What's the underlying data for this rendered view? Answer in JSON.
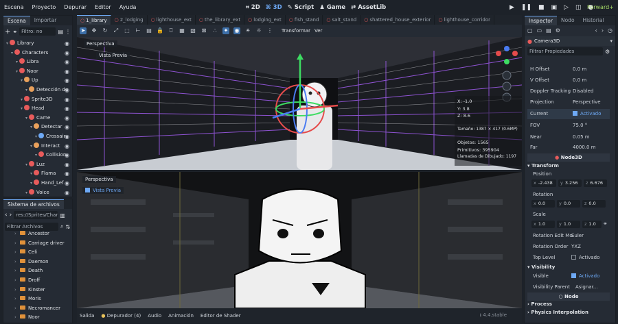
{
  "menubar": {
    "items": [
      "Escena",
      "Proyecto",
      "Depurar",
      "Editor",
      "Ayuda"
    ],
    "workspace_tabs": [
      "2D",
      "3D",
      "Script",
      "Game",
      "AssetLib"
    ],
    "renderer": "Forward+"
  },
  "scene_dock": {
    "tabs": [
      "Escena",
      "Importar"
    ],
    "filter_placeholder": "Filtro: no",
    "tree": [
      {
        "label": "Library",
        "indent": 0,
        "color": "#e85b5b"
      },
      {
        "label": "Characters",
        "indent": 1,
        "color": "#e85b5b"
      },
      {
        "label": "Libra",
        "indent": 2,
        "color": "#e85b5b"
      },
      {
        "label": "Noor",
        "indent": 2,
        "color": "#e85b5b"
      },
      {
        "label": "Up",
        "indent": 3,
        "color": "#e8a05b"
      },
      {
        "label": "Detección de",
        "indent": 4,
        "color": "#e8a05b"
      },
      {
        "label": "Sprite3D",
        "indent": 3,
        "color": "#e85b5b"
      },
      {
        "label": "Head",
        "indent": 3,
        "color": "#e85b5b"
      },
      {
        "label": "Came",
        "indent": 4,
        "color": "#e85b5b"
      },
      {
        "label": "Detectar",
        "indent": 5,
        "color": "#e8a05b"
      },
      {
        "label": "Crossair",
        "indent": 6,
        "color": "#6ea9f5"
      },
      {
        "label": "Interact",
        "indent": 5,
        "color": "#e8a05b"
      },
      {
        "label": "Collision",
        "indent": 6,
        "color": "#e85b5b"
      },
      {
        "label": "Luz",
        "indent": 4,
        "color": "#e85b5b"
      },
      {
        "label": "Flama",
        "indent": 5,
        "color": "#e85b5b"
      },
      {
        "label": "Hand_Lef",
        "indent": 5,
        "color": "#e85b5b"
      },
      {
        "label": "Voice",
        "indent": 4,
        "color": "#e85b5b"
      }
    ]
  },
  "filesystem_dock": {
    "title": "Sistema de archivos",
    "path": "res://Sprites/Chara",
    "filter_placeholder": "Filtrar Archivos",
    "folders": [
      "Ancestor",
      "Carriage driver",
      "Celi",
      "Daemon",
      "Death",
      "Droff",
      "Kinster",
      "Moris",
      "Necromancer",
      "Noor"
    ]
  },
  "editor_tabs": [
    "1_library",
    "2_lodging",
    "lighthouse_ext",
    "the_library_ext",
    "lodging_ext",
    "fish_stand",
    "salt_stand",
    "shattered_house_exterior",
    "lighthouse_corridor"
  ],
  "toolbar": {
    "transform_label": "Transformar",
    "view_label": "Ver"
  },
  "viewport_top": {
    "perspective_label": "Perspectiva",
    "preview_label": "Vista Previa",
    "stats": {
      "x": "X: -1.0",
      "y": "Y: 3.8",
      "z": "Z: 8.6",
      "size": "Tamaño: 1387 × 417 (0.6MP)",
      "objects": "Objetos: 1565",
      "primitives": "Primitivos: 395904",
      "draw_calls": "Llamadas de Dibujado: 1197"
    }
  },
  "viewport_bottom": {
    "perspective_label": "Perspectiva",
    "preview_label": "Vista Previa"
  },
  "bottom_panel": {
    "tabs": [
      "Salida",
      "Depurador (4)",
      "Audio",
      "Animación",
      "Editor de Shader"
    ],
    "version": "4.4.stable"
  },
  "inspector": {
    "tabs": [
      "Inspector",
      "Nodo",
      "Historial"
    ],
    "node_name": "Camera3D",
    "filter_placeholder": "Filtrar Propiedades",
    "props": [
      {
        "label": "H Offset",
        "value": "0.0 m"
      },
      {
        "label": "V Offset",
        "value": "0.0 m"
      },
      {
        "label": "Doppler Tracking",
        "value": "Disabled"
      },
      {
        "label": "Projection",
        "value": "Perspective"
      },
      {
        "label": "Current",
        "value": "Activado"
      },
      {
        "label": "FOV",
        "value": "75.0 °"
      },
      {
        "label": "Near",
        "value": "0.05 m"
      },
      {
        "label": "Far",
        "value": "4000.0 m"
      }
    ],
    "node3d_header": "Node3D",
    "transform_section": "Transform",
    "position_label": "Position",
    "position": {
      "x": "-2.438",
      "y": "3.256",
      "z": "6.676"
    },
    "rotation_label": "Rotation",
    "rotation": {
      "x": "0.0",
      "y": "0.0",
      "z": "0.0"
    },
    "scale_label": "Scale",
    "scale": {
      "x": "1.0",
      "y": "1.0",
      "z": "1.0"
    },
    "rotation_edit_mode": {
      "label": "Rotation Edit Mo",
      "value": "Euler"
    },
    "rotation_order": {
      "label": "Rotation Order",
      "value": "YXZ"
    },
    "top_level": {
      "label": "Top Level",
      "value": "Activado"
    },
    "visibility_section": "Visibility",
    "visible": {
      "label": "Visible",
      "value": "Activado"
    },
    "visibility_parent": {
      "label": "Visibility Parent",
      "value": "Asignar..."
    },
    "node_header": "Node",
    "process_section": "Process",
    "physics_section": "Physics Interpolation"
  }
}
